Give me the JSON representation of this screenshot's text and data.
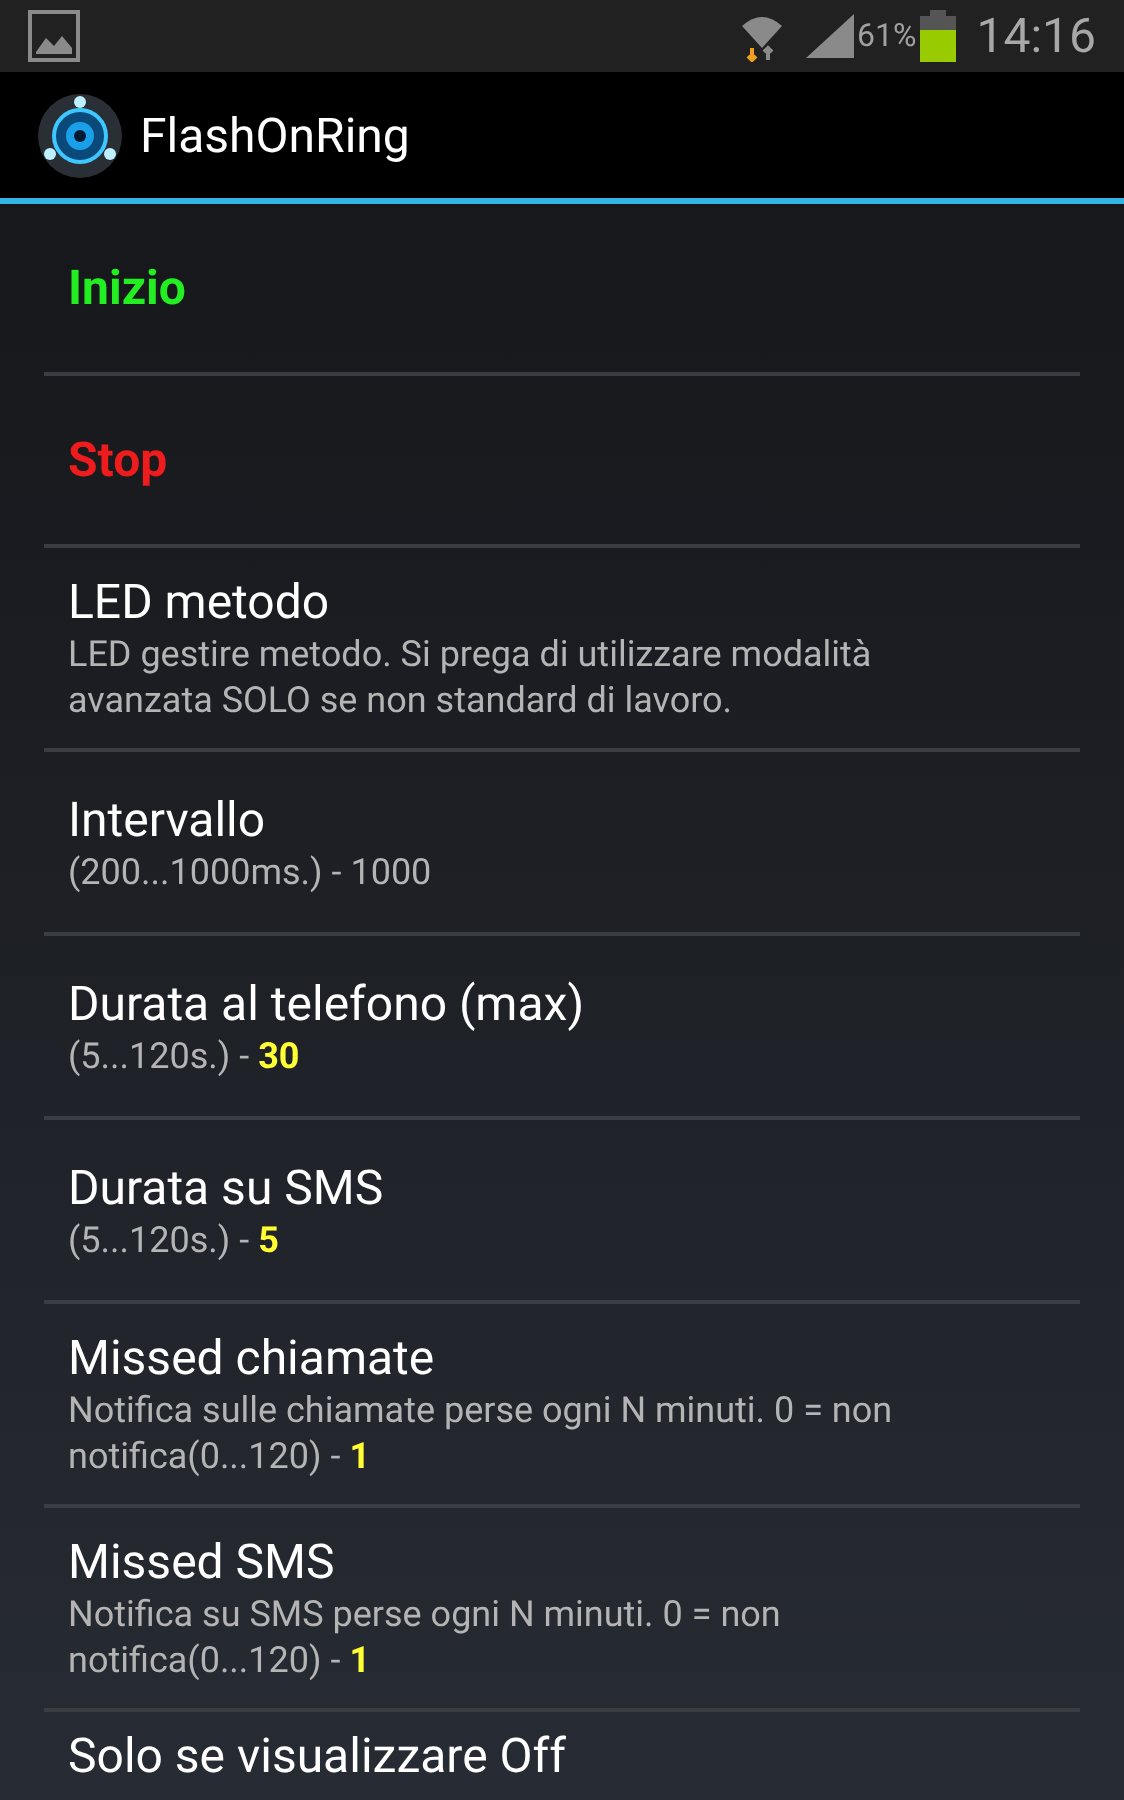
{
  "status_bar": {
    "battery": "61%",
    "time": "14:16"
  },
  "app_bar": {
    "title": "FlashOnRing"
  },
  "items": [
    {
      "kind": "action",
      "title": "Inizio",
      "color": "#22ee22"
    },
    {
      "kind": "action",
      "title": "Stop",
      "color": "#ee1c1c"
    },
    {
      "kind": "pref",
      "title": "LED metodo",
      "summary": "LED gestire metodo. Si prega di utilizzare modalità avanzata SOLO se non standard di lavoro."
    },
    {
      "kind": "pref",
      "title": "Intervallo",
      "summary": "(200...1000ms.) - 1000"
    },
    {
      "kind": "pref",
      "title": "Durata al telefono (max)",
      "summary": "(5...120s.) - **30**"
    },
    {
      "kind": "pref",
      "title": "Durata su SMS",
      "summary": "(5...120s.) - **5**"
    },
    {
      "kind": "pref",
      "title": "Missed chiamate",
      "summary": "Notifica sulle chiamate perse ogni N minuti. 0 = non notifica(0...120) - **1**"
    },
    {
      "kind": "pref",
      "title": "Missed SMS",
      "summary": "Notifica su SMS perse ogni N minuti. 0 = non notifica(0...120) - **1**"
    },
    {
      "kind": "pref",
      "title": "Solo se visualizzare Off"
    }
  ]
}
